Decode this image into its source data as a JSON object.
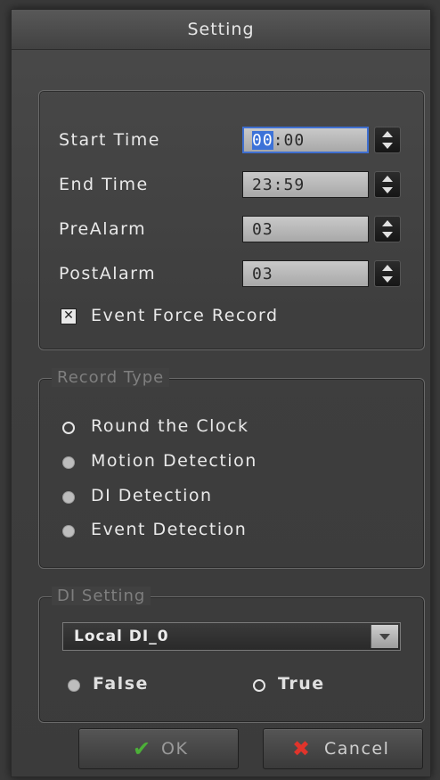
{
  "dialog": {
    "title": "Setting"
  },
  "schedule": {
    "rows": [
      {
        "label": "Start Time",
        "value_hl": "00",
        "value_rest": ":00"
      },
      {
        "label": "End Time",
        "value": "23:59"
      },
      {
        "label": "PreAlarm",
        "value": "03"
      },
      {
        "label": "PostAlarm",
        "value": "03"
      }
    ],
    "event_force_record": {
      "label": "Event Force Record",
      "checked": true
    }
  },
  "record_type": {
    "legend": "Record Type",
    "options": [
      {
        "label": "Round the Clock",
        "selected": true
      },
      {
        "label": "Motion Detection",
        "selected": false
      },
      {
        "label": "DI Detection",
        "selected": false
      },
      {
        "label": "Event Detection",
        "selected": false
      }
    ]
  },
  "di_setting": {
    "legend": "DI Setting",
    "select_value": "Local DI_0",
    "false_label": "False",
    "true_label": "True",
    "selected": "True"
  },
  "buttons": {
    "ok": "OK",
    "cancel": "Cancel"
  },
  "icons": {
    "ok": "check-icon",
    "cancel": "cross-icon"
  },
  "colors": {
    "accent": "#3c72d8",
    "ok_icon": "#4caf38",
    "cancel_icon": "#e0342b"
  }
}
